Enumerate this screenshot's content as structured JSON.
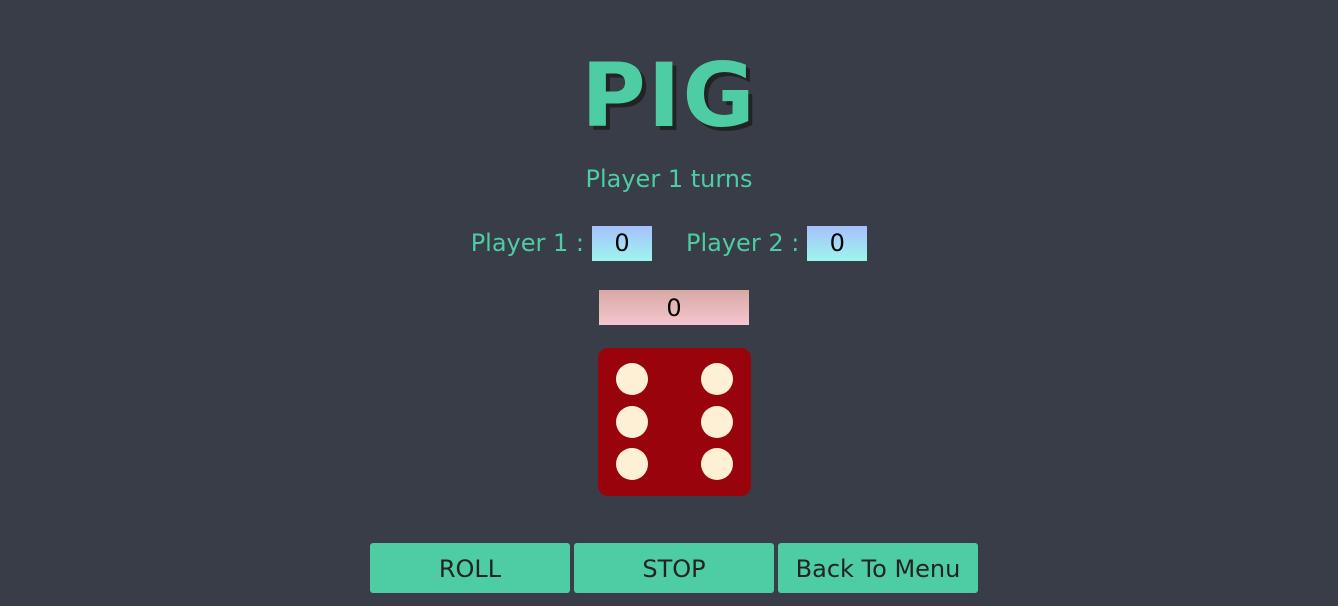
{
  "game": {
    "title": "PIG",
    "turn_text": "Player 1 turns"
  },
  "scores": {
    "player1_label": "Player 1 :",
    "player1_score": "0",
    "player2_label": "Player 2 :",
    "player2_score": "0"
  },
  "current_score": "0",
  "die": {
    "value": 6
  },
  "buttons": {
    "roll": "ROLL",
    "stop": "STOP",
    "menu": "Back To Menu"
  },
  "colors": {
    "background": "#393d47",
    "accent": "#4ecca3",
    "die": "#99040c",
    "pip": "#fdf0d5"
  }
}
